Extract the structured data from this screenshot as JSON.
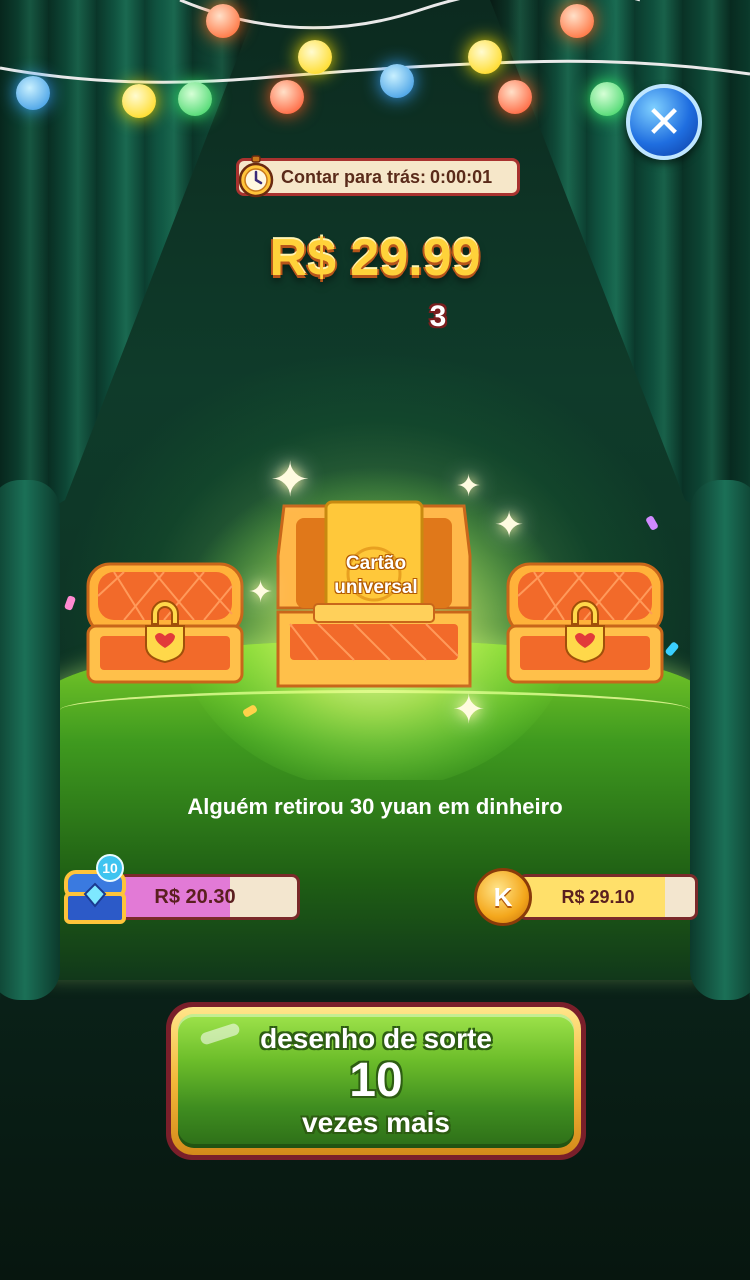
{
  "countdown": {
    "label": "Contar para trás:",
    "time": "0:00:01"
  },
  "price": "R$ 29.99",
  "remaining_count": "3",
  "card": {
    "line1": "Cartão",
    "line2": "universal"
  },
  "message": "Alguém retirou 30 yuan em dinheiro",
  "left_progress": {
    "value_text": "R$ 20.30",
    "badge": "10",
    "fill_fraction": 0.62
  },
  "right_progress": {
    "value_text": "R$ 29.10",
    "coin_letter": "K",
    "fill_fraction": 0.83
  },
  "draw_button": {
    "line1": "desenho de sorte",
    "line2": "10",
    "line3": "vezes mais"
  },
  "close_button": {
    "glyph": "✕"
  },
  "colors": {
    "accent_gold": "#ffd23a",
    "button_green": "#6cbd2a",
    "close_blue": "#1f6ee0"
  }
}
